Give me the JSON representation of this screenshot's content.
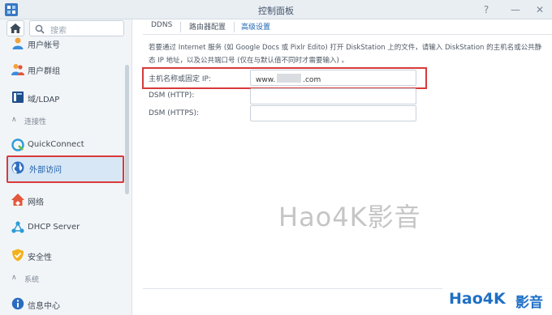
{
  "window": {
    "title": "控制面板",
    "help": "?",
    "minimize": "—",
    "close": "✕"
  },
  "sidebar": {
    "search_placeholder": "搜索",
    "items": [
      {
        "label": "用户帐号",
        "icon": "user-icon"
      },
      {
        "label": "用户群组",
        "icon": "group-icon"
      },
      {
        "label": "域/LDAP",
        "icon": "domain-icon"
      },
      {
        "section": "连接性"
      },
      {
        "label": "QuickConnect",
        "icon": "quickconnect-icon"
      },
      {
        "label": "外部访问",
        "icon": "globe-icon",
        "active": true
      },
      {
        "label": "网络",
        "icon": "network-icon"
      },
      {
        "label": "DHCP Server",
        "icon": "dhcp-icon"
      },
      {
        "label": "安全性",
        "icon": "shield-icon"
      },
      {
        "section": "系统"
      },
      {
        "label": "信息中心",
        "icon": "info-icon"
      }
    ],
    "labels": {
      "user_account": "用户帐号",
      "user_group": "用户群组",
      "domain_ldap": "域/LDAP",
      "section_connectivity": "连接性",
      "quickconnect": "QuickConnect",
      "external_access": "外部访问",
      "network": "网络",
      "dhcp": "DHCP Server",
      "security": "安全性",
      "section_system": "系统",
      "info_center": "信息中心"
    }
  },
  "tabs": {
    "ddns": "DDNS",
    "router": "路由器配置",
    "advanced": "高级设置"
  },
  "main": {
    "description_line1": "若要通过 Internet 服务 (如 Google Docs 或 Pixlr Edito) 打开 DiskStation 上的文件，请输入 DiskStation 的主机名或公共静",
    "description_line2": "态 IP 地址，以及公共端口号 (仅在与默认值不同时才需要输入) 。",
    "hostname_label": "主机名称或固定 IP:",
    "hostname_prefix": "www.",
    "hostname_suffix": ".com",
    "dsm_http_label": "DSM (HTTP):",
    "dsm_http_value": "",
    "dsm_https_label": "DSM (HTTPS):",
    "dsm_https_value": ""
  },
  "watermark": {
    "big": "Hao4K影音",
    "small_en": "Hao4K",
    "small_cn": "影音"
  },
  "colors": {
    "accent": "#1c64b4",
    "highlight": "#d83a3a",
    "active_bg": "#d7e7f6"
  }
}
